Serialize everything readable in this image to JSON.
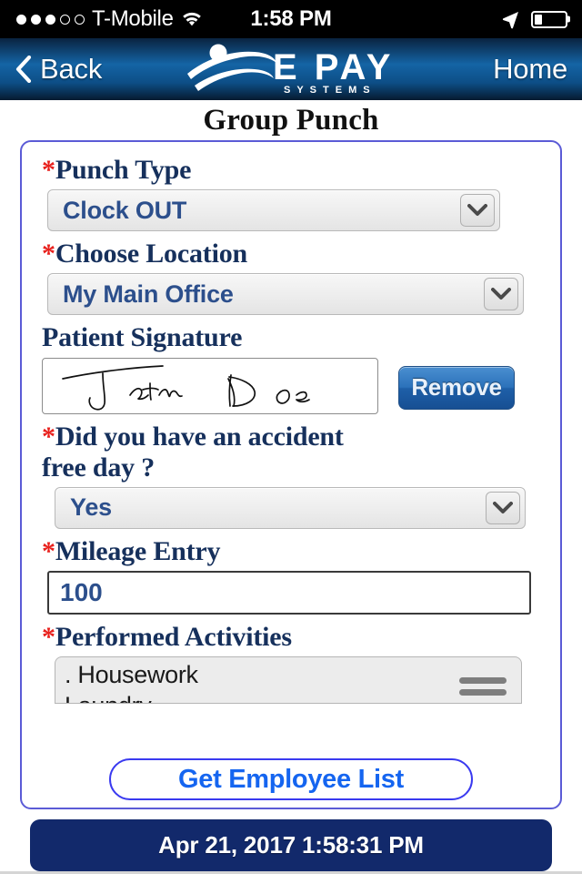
{
  "status_bar": {
    "signal_dots_filled": 3,
    "signal_dots_total": 5,
    "carrier": "T-Mobile",
    "wifi_icon": "wifi-icon",
    "time": "1:58 PM",
    "location_icon": "location-arrow-icon",
    "battery_icon": "battery-icon",
    "battery_percent": 25
  },
  "nav_bar": {
    "back_label": "Back",
    "back_icon": "chevron-left-icon",
    "logo_text": "EPAY",
    "logo_subtext": "SYSTEMS",
    "home_label": "Home"
  },
  "page": {
    "title": "Group Punch"
  },
  "form": {
    "punch_type": {
      "label": "Punch Type",
      "required": true,
      "required_mark": "*",
      "value": "Clock OUT",
      "dropdown_icon": "chevron-down-icon"
    },
    "choose_location": {
      "label": "Choose Location",
      "required": true,
      "required_mark": "*",
      "value": "My Main Office",
      "dropdown_icon": "chevron-down-icon"
    },
    "patient_signature": {
      "label": "Patient Signature",
      "required": false,
      "signature_text": "John Doe",
      "remove_label": "Remove"
    },
    "accident_free": {
      "label_line1": "Did you have an accident",
      "label_line2": "free day ?",
      "required": true,
      "required_mark": "*",
      "value": "Yes",
      "dropdown_icon": "chevron-down-icon"
    },
    "mileage_entry": {
      "label": "Mileage Entry",
      "required": true,
      "required_mark": "*",
      "value": "100"
    },
    "performed_activities": {
      "label": "Performed Activities",
      "required": true,
      "required_mark": "*",
      "items": [
        ". Housework",
        "Laundry"
      ],
      "drag_handle_icon": "drag-handle-icon"
    },
    "get_employee_list_label": "Get Employee List"
  },
  "footer": {
    "timestamp": "Apr 21, 2017 1:58:31 PM"
  },
  "colors": {
    "nav_blue": "#1464a5",
    "label_navy": "#16305c",
    "required_red": "#e8201c",
    "value_blue": "#2c4f8c",
    "accent_border": "#5b5bd6",
    "link_blue": "#1565f0",
    "timestamp_bg": "#12296b",
    "remove_btn_blue": "#2c72bb"
  }
}
